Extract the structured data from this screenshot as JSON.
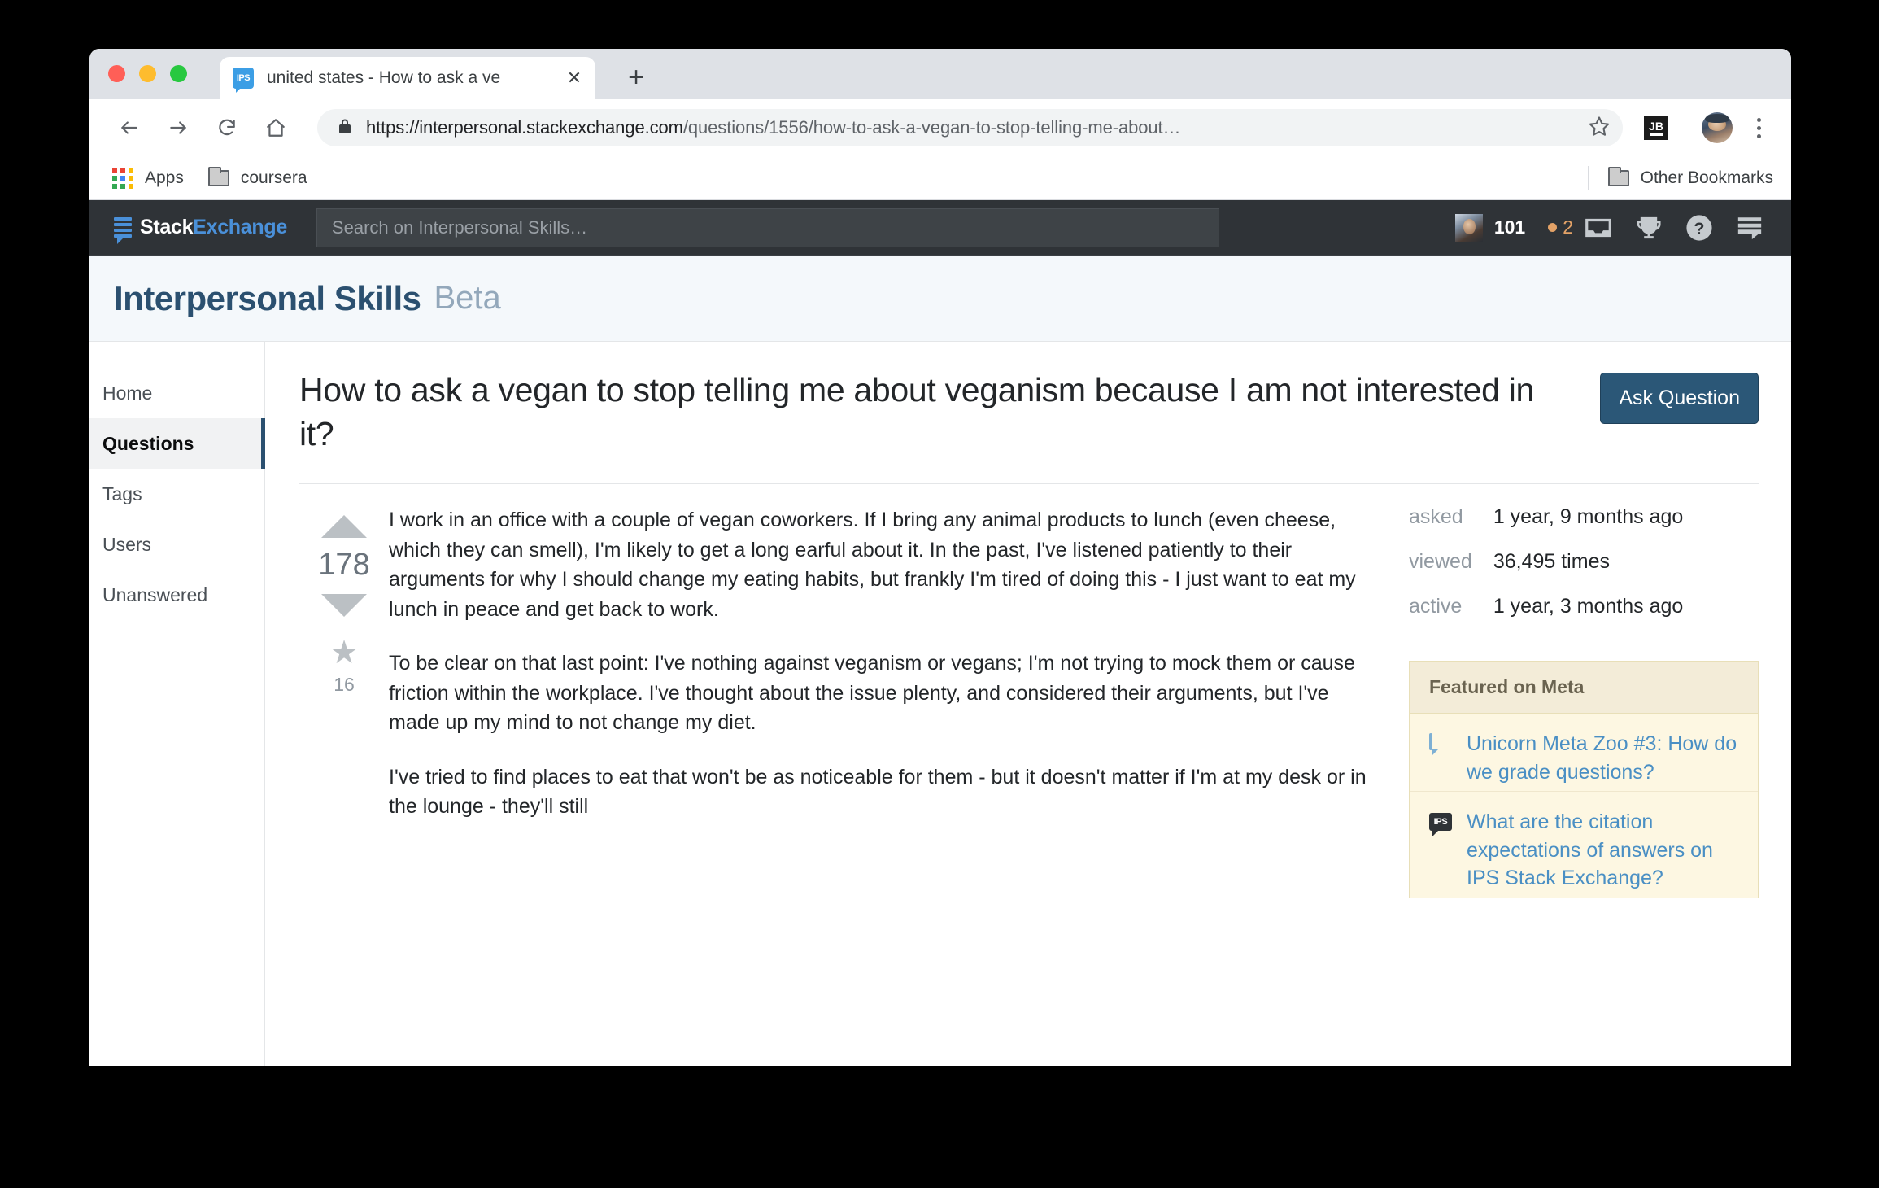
{
  "browser": {
    "tab": {
      "favicon_label": "IPS",
      "title": "united states - How to ask a ve",
      "close_label": "✕"
    },
    "new_tab_label": "+",
    "url_host": "https://interpersonal.stackexchange.com",
    "url_path": "/questions/1556/how-to-ask-a-vegan-to-stop-telling-me-about…",
    "extension_label": "JB",
    "bookmarks": {
      "apps_label": "Apps",
      "folder_label": "coursera",
      "other_bookmarks_label": "Other Bookmarks"
    }
  },
  "topbar": {
    "logo_first": "Stack",
    "logo_second": "Exchange",
    "search_placeholder": "Search on Interpersonal Skills…",
    "search_value": "",
    "reputation": "101",
    "badge_count": "2",
    "icons": [
      "inbox-icon",
      "achievements-trophy-icon",
      "help-question-icon",
      "site-switcher-icon"
    ]
  },
  "site": {
    "title": "Interpersonal Skills",
    "beta_label": "Beta"
  },
  "sidebar": {
    "items": [
      {
        "label": "Home",
        "active": false
      },
      {
        "label": "Questions",
        "active": true
      },
      {
        "label": "Tags",
        "active": false
      },
      {
        "label": "Users",
        "active": false
      },
      {
        "label": "Unanswered",
        "active": false
      }
    ]
  },
  "question": {
    "title": "How to ask a vegan to stop telling me about veganism because I am not interested in it?",
    "ask_button": "Ask Question",
    "votes": "178",
    "favorites": "16",
    "paragraphs": [
      "I work in an office with a couple of vegan coworkers. If I bring any animal products to lunch (even cheese, which they can smell), I'm likely to get a long earful about it. In the past, I've listened patiently to their arguments for why I should change my eating habits, but frankly I'm tired of doing this - I just want to eat my lunch in peace and get back to work.",
      "To be clear on that last point: I've nothing against veganism or vegans; I'm not trying to mock them or cause friction within the workplace. I've thought about the issue plenty, and considered their arguments, but I've made up my mind to not change my diet.",
      "I've tried to find places to eat that won't be as noticeable for them - but it doesn't matter if I'm at my desk or in the lounge - they'll still"
    ]
  },
  "stats": [
    {
      "key": "asked",
      "value": "1 year, 9 months ago"
    },
    {
      "key": "viewed",
      "value": "36,495 times"
    },
    {
      "key": "active",
      "value": "1 year, 3 months ago"
    }
  ],
  "featured": {
    "heading": "Featured on Meta",
    "items": [
      {
        "icon": "meta-bubble-icon",
        "text": "Unicorn Meta Zoo #3: How do we grade questions?"
      },
      {
        "icon": "ips-bubble-icon",
        "text": "What are the citation expectations of answers on IPS Stack Exchange?"
      }
    ]
  },
  "colors": {
    "accent": "#2b5070",
    "link": "#4a8fc4",
    "topbar_bg": "#2f3337",
    "badge": "#e3a267"
  }
}
